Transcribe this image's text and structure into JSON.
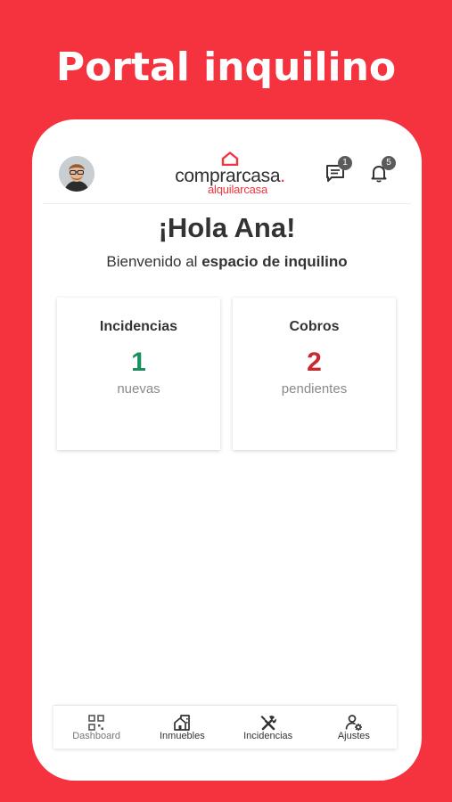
{
  "promo": {
    "title": "Portal inquilino"
  },
  "header": {
    "logo_main": "comprarcasa",
    "logo_dot": ".",
    "logo_sub": "alquilarcasa",
    "messages_badge": "1",
    "notifications_badge": "5"
  },
  "greeting": {
    "title": "¡Hola Ana!",
    "welcome_prefix": "Bienvenido al ",
    "welcome_bold": "espacio de inquilino"
  },
  "cards": [
    {
      "title": "Incidencias",
      "value": "1",
      "sub": "nuevas",
      "color": "#17905b"
    },
    {
      "title": "Cobros",
      "value": "2",
      "sub": "pendientes",
      "color": "#c8282e"
    }
  ],
  "nav": [
    {
      "label": "Dashboard",
      "icon": "dashboard-icon"
    },
    {
      "label": "Inmuebles",
      "icon": "property-icon"
    },
    {
      "label": "Incidencias",
      "icon": "tools-icon"
    },
    {
      "label": "Ajustes",
      "icon": "user-settings-icon"
    }
  ],
  "colors": {
    "brand": "#f4333f",
    "text": "#333333",
    "muted": "#8a8a8a"
  }
}
